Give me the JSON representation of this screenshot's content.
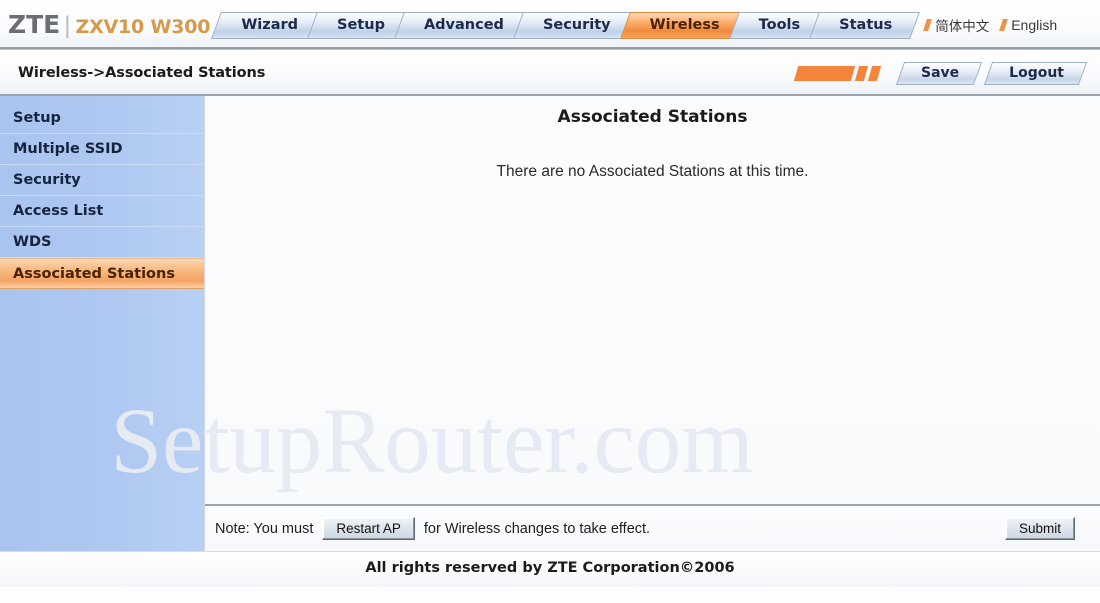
{
  "header": {
    "brand_name": "ZTE",
    "brand_separator": "|",
    "brand_model": "ZXV10 W300",
    "tabs": [
      {
        "label": "Wizard",
        "active": false
      },
      {
        "label": "Setup",
        "active": false
      },
      {
        "label": "Advanced",
        "active": false
      },
      {
        "label": "Security",
        "active": false
      },
      {
        "label": "Wireless",
        "active": true
      },
      {
        "label": "Tools",
        "active": false
      },
      {
        "label": "Status",
        "active": false
      }
    ],
    "languages": [
      {
        "label": "简体中文"
      },
      {
        "label": "English"
      }
    ]
  },
  "commandbar": {
    "breadcrumb": "Wireless->Associated Stations",
    "save_label": "Save",
    "logout_label": "Logout"
  },
  "sidebar": {
    "items": [
      {
        "label": "Setup",
        "active": false
      },
      {
        "label": "Multiple SSID",
        "active": false
      },
      {
        "label": "Security",
        "active": false
      },
      {
        "label": "Access List",
        "active": false
      },
      {
        "label": "WDS",
        "active": false
      },
      {
        "label": "Associated Stations",
        "active": true
      }
    ]
  },
  "main": {
    "title": "Associated Stations",
    "empty_message": "There are no Associated Stations at this time.",
    "watermark": "SetupRouter.com"
  },
  "notebar": {
    "note_prefix": "Note: You must",
    "restart_label": "Restart AP",
    "note_suffix": "for Wireless changes to take effect.",
    "submit_label": "Submit"
  },
  "footer": {
    "copyright": "All rights reserved by ZTE Corporation©2006"
  },
  "colors": {
    "accent_orange": "#f4853c",
    "tab_blue": "#bed2e8",
    "sidebar_blue": "#aec8f1",
    "active_item": "#f4a463",
    "brand_gray": "#6b6f73",
    "brand_model_orange": "#d79a4a"
  }
}
